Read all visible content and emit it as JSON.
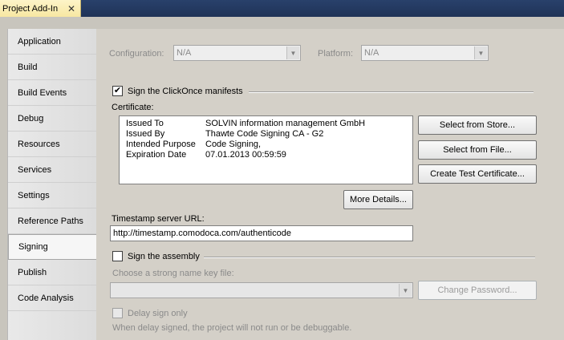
{
  "window": {
    "tab_title": "Project Add-In",
    "tab_close": "✕"
  },
  "sidebar": {
    "items": [
      {
        "label": "Application"
      },
      {
        "label": "Build"
      },
      {
        "label": "Build Events"
      },
      {
        "label": "Debug"
      },
      {
        "label": "Resources"
      },
      {
        "label": "Services"
      },
      {
        "label": "Settings"
      },
      {
        "label": "Reference Paths"
      },
      {
        "label": "Signing"
      },
      {
        "label": "Publish"
      },
      {
        "label": "Code Analysis"
      }
    ],
    "selected": "Signing"
  },
  "config": {
    "configuration_label": "Configuration:",
    "configuration_value": "N/A",
    "platform_label": "Platform:",
    "platform_value": "N/A"
  },
  "signing": {
    "sign_clickonce_label": "Sign the ClickOnce manifests",
    "sign_clickonce_checked": "✔",
    "certificate_label": "Certificate:",
    "certificate": {
      "issued_to_key": "Issued To",
      "issued_to_value": "SOLVIN information management GmbH",
      "issued_by_key": "Issued By",
      "issued_by_value": "Thawte Code Signing CA - G2",
      "purpose_key": "Intended Purpose",
      "purpose_value": "Code Signing,",
      "expiration_key": "Expiration Date",
      "expiration_value": "07.01.2013 00:59:59"
    },
    "select_from_store": "Select from Store...",
    "select_from_file": "Select from File...",
    "create_test_certificate": "Create Test Certificate...",
    "more_details": "More Details...",
    "timestamp_label": "Timestamp server URL:",
    "timestamp_value": "http://timestamp.comodoca.com/authenticode",
    "sign_assembly_label": "Sign the assembly",
    "strong_name_label": "Choose a strong name key file:",
    "strong_name_value": "",
    "change_password": "Change Password...",
    "delay_sign_label": "Delay sign only",
    "delay_sign_note": "When delay signed, the project will not run or be debuggable."
  },
  "colors": {
    "title_bar": "#1f3357",
    "tab_active": "#f7e7a2",
    "panel_bg": "#d4d0c8"
  }
}
